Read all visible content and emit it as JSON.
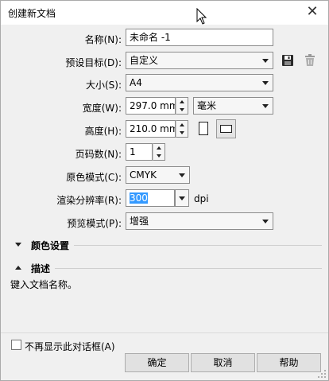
{
  "window": {
    "title": "创建新文档"
  },
  "fields": {
    "name": {
      "label": "名称(N):",
      "value": "未命名 -1"
    },
    "preset": {
      "label": "预设目标(D):",
      "value": "自定义"
    },
    "size": {
      "label": "大小(S):",
      "value": "A4"
    },
    "width": {
      "label": "宽度(W):",
      "value": "297.0 mm",
      "unit": "毫米"
    },
    "height": {
      "label": "高度(H):",
      "value": "210.0 mm"
    },
    "pages": {
      "label": "页码数(N):",
      "value": "1"
    },
    "color_mode": {
      "label": "原色模式(C):",
      "value": "CMYK"
    },
    "resolution": {
      "label": "渲染分辨率(R):",
      "value": "300",
      "unit": "dpi"
    },
    "preview_mode": {
      "label": "预览模式(P):",
      "value": "增强"
    }
  },
  "sections": {
    "color_settings": "颜色设置",
    "description": "描述"
  },
  "description_text": "键入文档名称。",
  "footer": {
    "dont_show": "不再显示此对话框(A)",
    "ok": "确定",
    "cancel": "取消",
    "help": "帮助"
  },
  "icons": {
    "save": "save-preset-icon",
    "delete": "delete-preset-icon",
    "portrait": "portrait-icon",
    "landscape": "landscape-icon",
    "close": "close-icon"
  }
}
